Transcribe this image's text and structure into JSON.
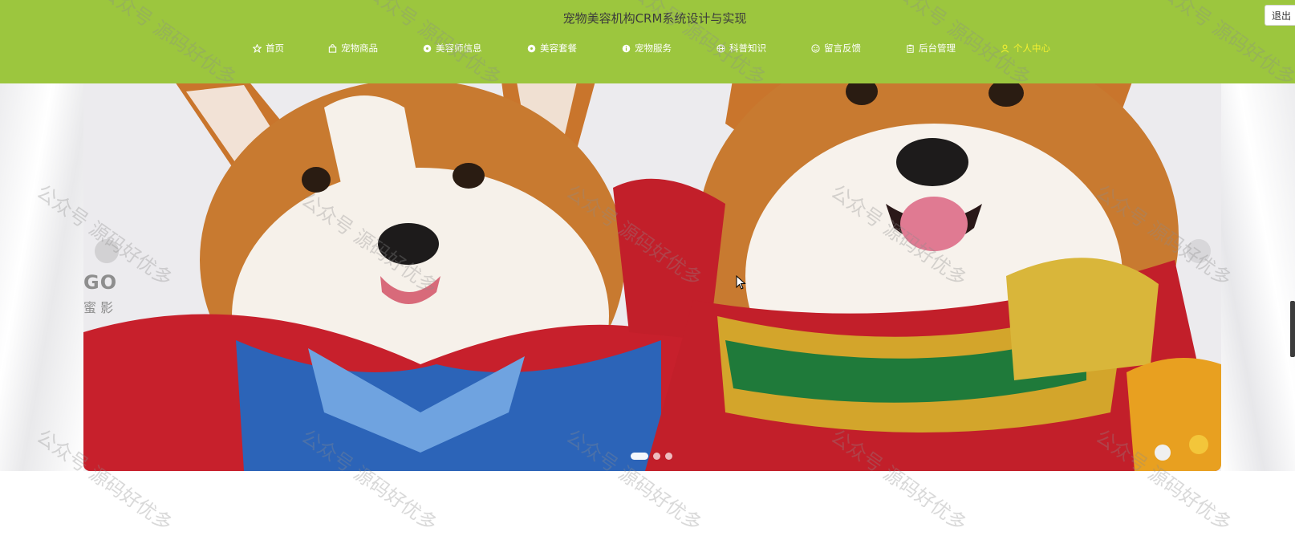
{
  "header": {
    "title": "宠物美容机构CRM系统设计与实现",
    "logout_label": "退出",
    "bg_color": "#9cc63e"
  },
  "nav": {
    "active_color": "#f4f030",
    "items": [
      {
        "label": "首页",
        "icon": "star-icon"
      },
      {
        "label": "宠物商品",
        "icon": "bag-icon"
      },
      {
        "label": "美容师信息",
        "icon": "dot-circle-icon"
      },
      {
        "label": "美容套餐",
        "icon": "dot-circle-icon"
      },
      {
        "label": "宠物服务",
        "icon": "info-circle-icon"
      },
      {
        "label": "科普知识",
        "icon": "globe-icon"
      },
      {
        "label": "留言反馈",
        "icon": "smile-icon"
      },
      {
        "label": "后台管理",
        "icon": "clipboard-icon"
      },
      {
        "label": "个人中心",
        "icon": "user-icon",
        "active": true
      }
    ]
  },
  "carousel": {
    "slide_count": 3,
    "active_index": 0,
    "slide_alt": "two corgis in festive costumes",
    "brand_mark": "GO",
    "brand_sub": "蜜 影"
  },
  "watermark": {
    "text": "公众号 源码好优多"
  }
}
